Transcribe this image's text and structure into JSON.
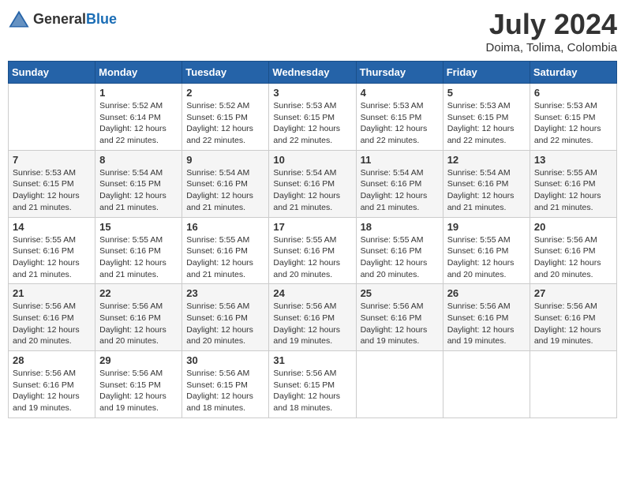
{
  "header": {
    "logo_general": "General",
    "logo_blue": "Blue",
    "month_year": "July 2024",
    "location": "Doima, Tolima, Colombia"
  },
  "days_of_week": [
    "Sunday",
    "Monday",
    "Tuesday",
    "Wednesday",
    "Thursday",
    "Friday",
    "Saturday"
  ],
  "weeks": [
    [
      {
        "day": "",
        "info": ""
      },
      {
        "day": "1",
        "info": "Sunrise: 5:52 AM\nSunset: 6:14 PM\nDaylight: 12 hours\nand 22 minutes."
      },
      {
        "day": "2",
        "info": "Sunrise: 5:52 AM\nSunset: 6:15 PM\nDaylight: 12 hours\nand 22 minutes."
      },
      {
        "day": "3",
        "info": "Sunrise: 5:53 AM\nSunset: 6:15 PM\nDaylight: 12 hours\nand 22 minutes."
      },
      {
        "day": "4",
        "info": "Sunrise: 5:53 AM\nSunset: 6:15 PM\nDaylight: 12 hours\nand 22 minutes."
      },
      {
        "day": "5",
        "info": "Sunrise: 5:53 AM\nSunset: 6:15 PM\nDaylight: 12 hours\nand 22 minutes."
      },
      {
        "day": "6",
        "info": "Sunrise: 5:53 AM\nSunset: 6:15 PM\nDaylight: 12 hours\nand 22 minutes."
      }
    ],
    [
      {
        "day": "7",
        "info": "Sunrise: 5:53 AM\nSunset: 6:15 PM\nDaylight: 12 hours\nand 21 minutes."
      },
      {
        "day": "8",
        "info": "Sunrise: 5:54 AM\nSunset: 6:15 PM\nDaylight: 12 hours\nand 21 minutes."
      },
      {
        "day": "9",
        "info": "Sunrise: 5:54 AM\nSunset: 6:16 PM\nDaylight: 12 hours\nand 21 minutes."
      },
      {
        "day": "10",
        "info": "Sunrise: 5:54 AM\nSunset: 6:16 PM\nDaylight: 12 hours\nand 21 minutes."
      },
      {
        "day": "11",
        "info": "Sunrise: 5:54 AM\nSunset: 6:16 PM\nDaylight: 12 hours\nand 21 minutes."
      },
      {
        "day": "12",
        "info": "Sunrise: 5:54 AM\nSunset: 6:16 PM\nDaylight: 12 hours\nand 21 minutes."
      },
      {
        "day": "13",
        "info": "Sunrise: 5:55 AM\nSunset: 6:16 PM\nDaylight: 12 hours\nand 21 minutes."
      }
    ],
    [
      {
        "day": "14",
        "info": "Sunrise: 5:55 AM\nSunset: 6:16 PM\nDaylight: 12 hours\nand 21 minutes."
      },
      {
        "day": "15",
        "info": "Sunrise: 5:55 AM\nSunset: 6:16 PM\nDaylight: 12 hours\nand 21 minutes."
      },
      {
        "day": "16",
        "info": "Sunrise: 5:55 AM\nSunset: 6:16 PM\nDaylight: 12 hours\nand 21 minutes."
      },
      {
        "day": "17",
        "info": "Sunrise: 5:55 AM\nSunset: 6:16 PM\nDaylight: 12 hours\nand 20 minutes."
      },
      {
        "day": "18",
        "info": "Sunrise: 5:55 AM\nSunset: 6:16 PM\nDaylight: 12 hours\nand 20 minutes."
      },
      {
        "day": "19",
        "info": "Sunrise: 5:55 AM\nSunset: 6:16 PM\nDaylight: 12 hours\nand 20 minutes."
      },
      {
        "day": "20",
        "info": "Sunrise: 5:56 AM\nSunset: 6:16 PM\nDaylight: 12 hours\nand 20 minutes."
      }
    ],
    [
      {
        "day": "21",
        "info": "Sunrise: 5:56 AM\nSunset: 6:16 PM\nDaylight: 12 hours\nand 20 minutes."
      },
      {
        "day": "22",
        "info": "Sunrise: 5:56 AM\nSunset: 6:16 PM\nDaylight: 12 hours\nand 20 minutes."
      },
      {
        "day": "23",
        "info": "Sunrise: 5:56 AM\nSunset: 6:16 PM\nDaylight: 12 hours\nand 20 minutes."
      },
      {
        "day": "24",
        "info": "Sunrise: 5:56 AM\nSunset: 6:16 PM\nDaylight: 12 hours\nand 19 minutes."
      },
      {
        "day": "25",
        "info": "Sunrise: 5:56 AM\nSunset: 6:16 PM\nDaylight: 12 hours\nand 19 minutes."
      },
      {
        "day": "26",
        "info": "Sunrise: 5:56 AM\nSunset: 6:16 PM\nDaylight: 12 hours\nand 19 minutes."
      },
      {
        "day": "27",
        "info": "Sunrise: 5:56 AM\nSunset: 6:16 PM\nDaylight: 12 hours\nand 19 minutes."
      }
    ],
    [
      {
        "day": "28",
        "info": "Sunrise: 5:56 AM\nSunset: 6:16 PM\nDaylight: 12 hours\nand 19 minutes."
      },
      {
        "day": "29",
        "info": "Sunrise: 5:56 AM\nSunset: 6:15 PM\nDaylight: 12 hours\nand 19 minutes."
      },
      {
        "day": "30",
        "info": "Sunrise: 5:56 AM\nSunset: 6:15 PM\nDaylight: 12 hours\nand 18 minutes."
      },
      {
        "day": "31",
        "info": "Sunrise: 5:56 AM\nSunset: 6:15 PM\nDaylight: 12 hours\nand 18 minutes."
      },
      {
        "day": "",
        "info": ""
      },
      {
        "day": "",
        "info": ""
      },
      {
        "day": "",
        "info": ""
      }
    ]
  ]
}
